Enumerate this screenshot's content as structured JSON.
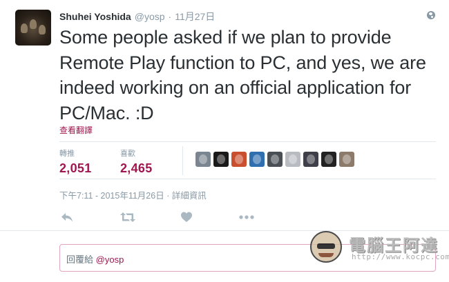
{
  "tweet": {
    "author_name": "Shuhei Yoshida",
    "author_handle": "@yosp",
    "separator": "·",
    "date": "11月27日",
    "text": "Some people asked if we plan to provide Remote Play function to PC, and yes, we are indeed working on an official application for PC/Mac. :D",
    "translate_label": "查看翻譯",
    "timestamp": "下午7:11 - 2015年11月26日 · 詳細資訊"
  },
  "stats": {
    "retweets_label": "轉推",
    "retweets_value": "2,051",
    "likes_label": "喜歡",
    "likes_value": "2,465"
  },
  "engagers": [
    {
      "icon": "avatar-icon",
      "color": "#7a8590"
    },
    {
      "icon": "avatar-icon",
      "color": "#1a1a1a"
    },
    {
      "icon": "avatar-icon",
      "color": "#c94f2e"
    },
    {
      "icon": "avatar-icon",
      "color": "#2f6fb0"
    },
    {
      "icon": "avatar-icon",
      "color": "#4a4f55"
    },
    {
      "icon": "avatar-icon",
      "color": "#b8bcc0"
    },
    {
      "icon": "avatar-icon",
      "color": "#3d4048"
    },
    {
      "icon": "avatar-icon",
      "color": "#222222"
    },
    {
      "icon": "avatar-icon",
      "color": "#8c7a6a"
    }
  ],
  "actions": {
    "reply": "reply-icon",
    "retweet": "retweet-icon",
    "like": "heart-icon",
    "more": "more-icon"
  },
  "reply_box": {
    "prefix": "回覆給",
    "mention": "@yosp"
  },
  "watermark": {
    "brand": "電腦王阿達",
    "url": "http://www.kocpc.com.tw"
  },
  "colors": {
    "accent": "#a0174f",
    "muted": "#8899a6",
    "text": "#292f33",
    "border": "#e1e8ed"
  }
}
